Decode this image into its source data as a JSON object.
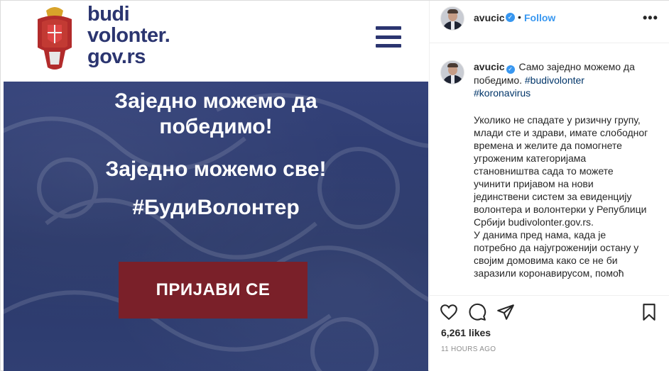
{
  "image": {
    "brand_lines": [
      "budi",
      "volonter.",
      "gov.rs"
    ],
    "headline_1": "Заједно можемо да победимо!",
    "headline_2": "Заједно можемо све!",
    "headline_3": "#БудиВолонтер",
    "cta_label": "ПРИЈАВИ СЕ",
    "colors": {
      "brand": "#2b3570",
      "background": "#2c3a6e",
      "cta": "#7a2029"
    }
  },
  "header": {
    "username": "avucic",
    "separator": "•",
    "follow_label": "Follow",
    "more_label": "•••"
  },
  "caption": {
    "username": "avucic",
    "text": "Само заједно можемо да победимо.",
    "hashtag_1": "#budivolonter",
    "hashtag_2": "#koronavirus",
    "body": "Уколико не спадате у ризичну групу, млади сте и здрави, имате слободног времена и желите да помогнете угроженим категоријама становништва сада то можете учинити пријавом на нови јединствени систем за евиденцију волонтера и волонтерки у Републици Србији budivolonter.gov.rs.\nУ данима пред нама, када је потребно да најугроженији остану у својим домовима како се не би заразили коронавирусом, помоћ"
  },
  "actions": {
    "likes": "6,261 likes",
    "timestamp": "11 HOURS AGO",
    "icons": [
      "heart-icon",
      "comment-icon",
      "share-icon",
      "bookmark-icon"
    ]
  },
  "colors": {
    "link": "#3897f0",
    "hashtag": "#003569",
    "muted": "#8e8e8e"
  }
}
